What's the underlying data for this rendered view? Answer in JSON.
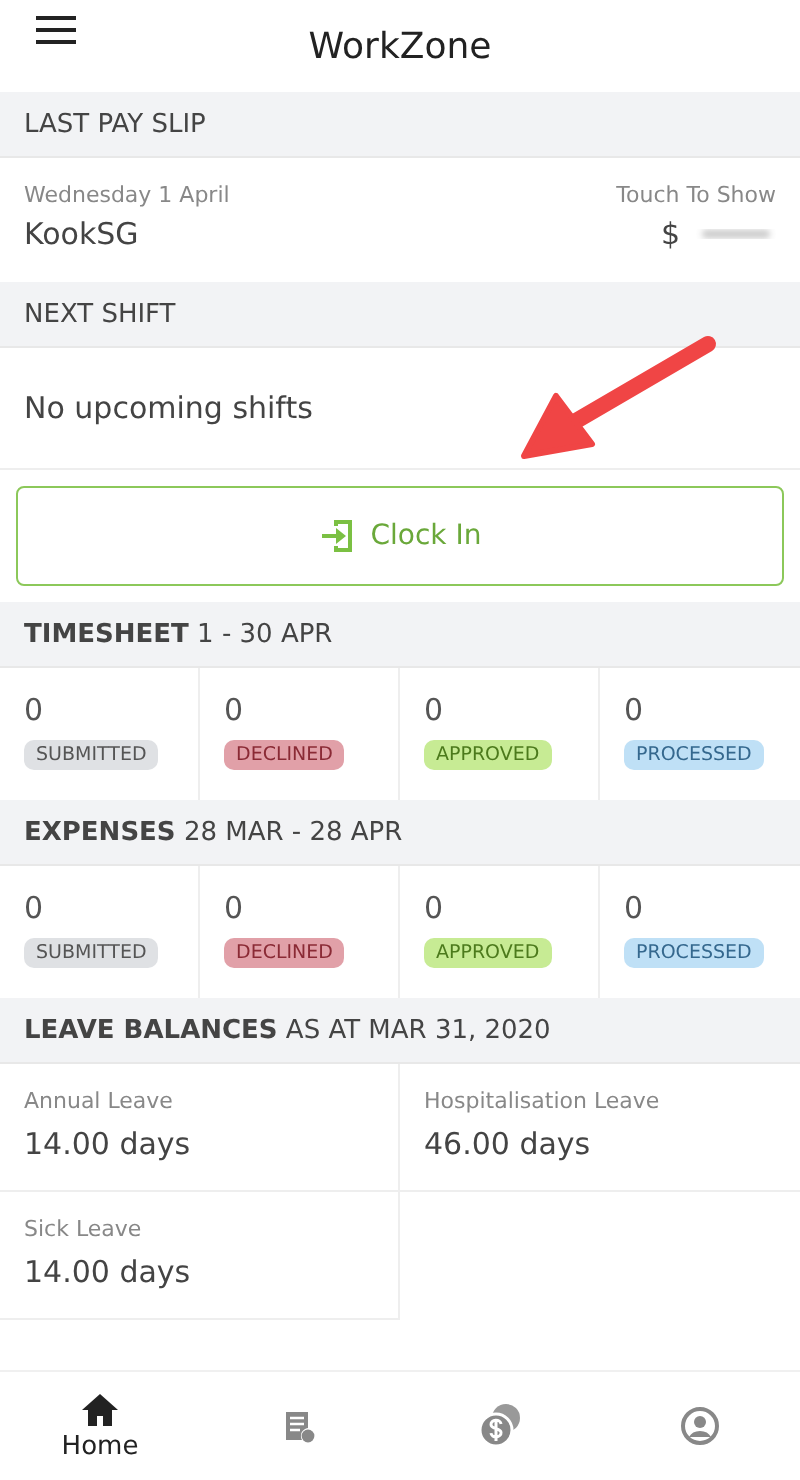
{
  "app_bar": {
    "title": "WorkZone"
  },
  "pay_slip": {
    "heading": "LAST PAY SLIP",
    "date": "Wednesday 1 April",
    "company": "KookSG",
    "hint": "Touch To Show",
    "currency": "$"
  },
  "next_shift": {
    "heading": "NEXT SHIFT",
    "message": "No upcoming shifts"
  },
  "clock_in": {
    "label": "Clock In"
  },
  "summaries": [
    {
      "heading": "**TIMESHEET** 1 - 30 APR",
      "stats": [
        {
          "count": "0",
          "status": "SUBMITTED",
          "kind": "submitted"
        },
        {
          "count": "0",
          "status": "DECLINED",
          "kind": "declined"
        },
        {
          "count": "0",
          "status": "APPROVED",
          "kind": "approved"
        },
        {
          "count": "0",
          "status": "PROCESSED",
          "kind": "processed"
        }
      ]
    },
    {
      "heading": "**EXPENSES** 28 MAR - 28 APR",
      "stats": [
        {
          "count": "0",
          "status": "SUBMITTED",
          "kind": "submitted"
        },
        {
          "count": "0",
          "status": "DECLINED",
          "kind": "declined"
        },
        {
          "count": "0",
          "status": "APPROVED",
          "kind": "approved"
        },
        {
          "count": "0",
          "status": "PROCESSED",
          "kind": "processed"
        }
      ]
    }
  ],
  "leave": {
    "heading": "**LEAVE BALANCES** AS AT MAR 31, 2020",
    "balances": [
      {
        "type": "Annual Leave",
        "value": "14.00 days"
      },
      {
        "type": "Hospitalisation Leave",
        "value": "46.00 days"
      },
      {
        "type": "Sick Leave",
        "value": "14.00 days"
      }
    ]
  },
  "bottom_nav": [
    {
      "kind": "home",
      "label": "Home",
      "selected": true
    },
    {
      "kind": "timesheet",
      "selected": false
    },
    {
      "kind": "expenses",
      "selected": false
    },
    {
      "kind": "profile",
      "selected": false
    }
  ]
}
